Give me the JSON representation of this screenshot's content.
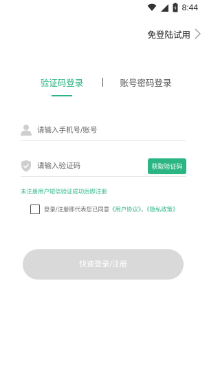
{
  "status_bar": {
    "time": "8:44",
    "icons": [
      "wifi-icon",
      "signal-icon",
      "battery-icon"
    ]
  },
  "header": {
    "skip_label": "免登陆试用",
    "skip_icon": "chevron-right-icon"
  },
  "tabs": [
    {
      "label": "验证码登录",
      "active": true
    },
    {
      "label": "账号密码登录",
      "active": false
    }
  ],
  "form": {
    "phone": {
      "icon": "user-icon",
      "placeholder": "请输入手机号/账号",
      "value": ""
    },
    "code": {
      "icon": "shield-icon",
      "placeholder": "请输入验证码",
      "value": "",
      "button_label": "获取验证码"
    },
    "hint": "未注册用户短信验证成功后即注册",
    "agreement": {
      "checked": false,
      "text": "登录/注册即代表您已同意",
      "user_agreement": "《用户协议》",
      "separator": "、",
      "privacy_policy": "《隐私政策》"
    },
    "submit_label": "快速登录/注册"
  },
  "colors": {
    "accent": "#2bb583",
    "disabled_button": "#d9d9d9",
    "divider": "#e6e6e6"
  }
}
